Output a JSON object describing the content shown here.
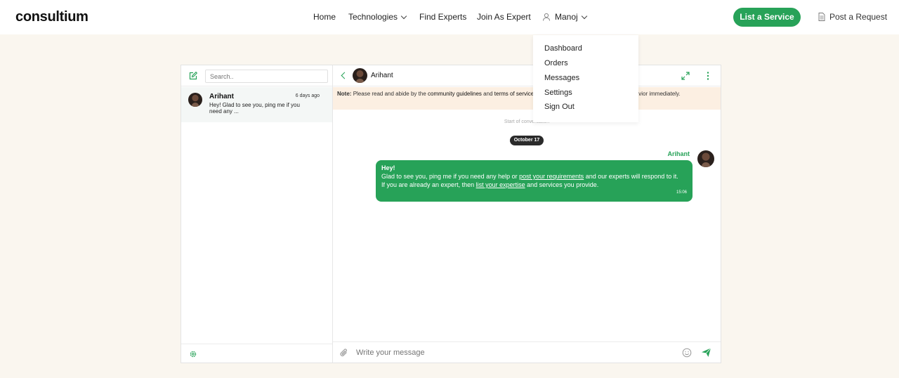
{
  "header": {
    "logo": "consultium",
    "nav": {
      "home": "Home",
      "technologies": "Technologies",
      "find_experts": "Find Experts",
      "join_expert": "Join As Expert",
      "user": "Manoj"
    },
    "list_service": "List a Service",
    "post_request": "Post a Request"
  },
  "dropdown": {
    "items": [
      "Dashboard",
      "Orders",
      "Messages",
      "Settings",
      "Sign Out"
    ]
  },
  "sidebar": {
    "search_placeholder": "Search..",
    "conversation": {
      "name": "Arihant",
      "time": "6 days ago",
      "preview": "Hey! Glad to see you, ping me if you need any ..."
    }
  },
  "chat": {
    "name": "Arihant",
    "note_label": "Note:",
    "note_text_1": "Please read and abide by the",
    "note_link_1": "community guidelines",
    "note_text_2": "and",
    "note_link_2": "terms of service",
    "note_text_3": "and report any unsafe or suspicious behavior immediately.",
    "start": "Start of conversation",
    "date": "October 17",
    "sender": "Arihant",
    "message": {
      "greeting": "Hey!",
      "line1a": "Glad to see you, ping me if you need any help or",
      "link1": "post your requirements",
      "line1b": "and our experts will respond to it.",
      "line2a": "If you are already an expert, then",
      "link2": "list your expertise",
      "line2b": "and services you provide.",
      "time": "15:06"
    },
    "input_placeholder": "Write your message"
  },
  "colors": {
    "accent": "#27a258",
    "background": "#faf6ef",
    "note_bg": "#fcefe2"
  }
}
